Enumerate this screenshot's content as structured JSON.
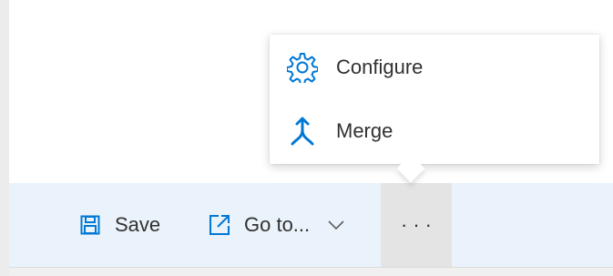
{
  "command_bar": {
    "save_label": "Save",
    "goto_label": "Go to...",
    "more_label": "···"
  },
  "overflow_menu": {
    "items": [
      {
        "label": "Configure",
        "icon": "gear-icon"
      },
      {
        "label": "Merge",
        "icon": "merge-icon"
      }
    ]
  },
  "colors": {
    "accent": "#0078d4",
    "command_bar_bg": "#eaf3fb",
    "text": "#323130"
  }
}
